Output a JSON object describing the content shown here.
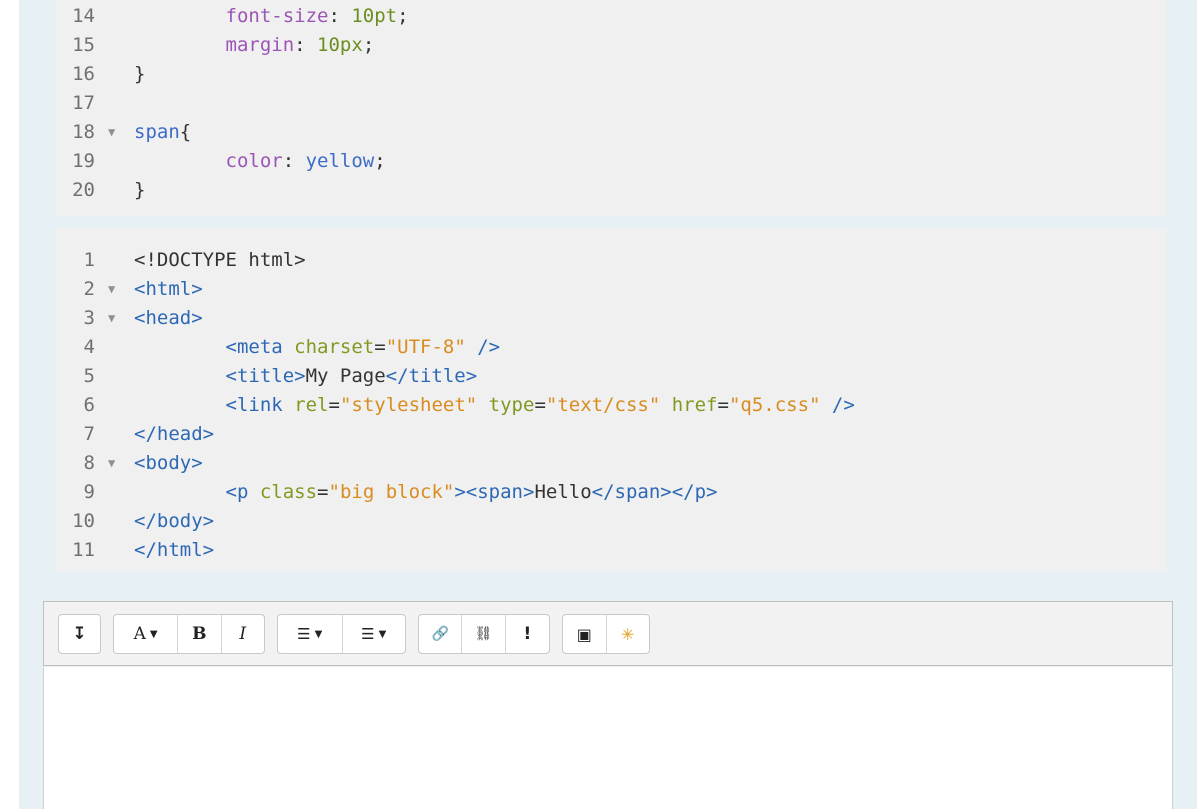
{
  "css_editor": {
    "lines": [
      {
        "num": "14",
        "fold": false,
        "segments": [
          {
            "t": "        "
          },
          {
            "t": "font-size",
            "c": "t-prop"
          },
          {
            "t": ": "
          },
          {
            "t": "10pt",
            "c": "t-num"
          },
          {
            "t": ";"
          }
        ]
      },
      {
        "num": "15",
        "fold": false,
        "segments": [
          {
            "t": "        "
          },
          {
            "t": "margin",
            "c": "t-prop"
          },
          {
            "t": ": "
          },
          {
            "t": "10px",
            "c": "t-num"
          },
          {
            "t": ";"
          }
        ]
      },
      {
        "num": "16",
        "fold": false,
        "segments": [
          {
            "t": "}"
          }
        ]
      },
      {
        "num": "17",
        "fold": false,
        "segments": []
      },
      {
        "num": "18",
        "fold": true,
        "segments": [
          {
            "t": "span",
            "c": "t-kw"
          },
          {
            "t": "{"
          }
        ]
      },
      {
        "num": "19",
        "fold": false,
        "segments": [
          {
            "t": "        "
          },
          {
            "t": "color",
            "c": "t-prop"
          },
          {
            "t": ": "
          },
          {
            "t": "yellow",
            "c": "t-kw"
          },
          {
            "t": ";"
          }
        ]
      },
      {
        "num": "20",
        "fold": false,
        "segments": [
          {
            "t": "}"
          }
        ]
      }
    ]
  },
  "html_editor": {
    "lines": [
      {
        "num": "1",
        "fold": false,
        "segments": [
          {
            "t": "<!DOCTYPE html>"
          }
        ]
      },
      {
        "num": "2",
        "fold": true,
        "segments": [
          {
            "t": "<html>",
            "c": "t-tag"
          }
        ]
      },
      {
        "num": "3",
        "fold": true,
        "segments": [
          {
            "t": "<head>",
            "c": "t-tag"
          }
        ]
      },
      {
        "num": "4",
        "fold": false,
        "segments": [
          {
            "t": "        "
          },
          {
            "t": "<meta ",
            "c": "t-tag"
          },
          {
            "t": "charset",
            "c": "t-attr"
          },
          {
            "t": "="
          },
          {
            "t": "\"UTF-8\"",
            "c": "t-str"
          },
          {
            "t": " />",
            "c": "t-tag"
          }
        ]
      },
      {
        "num": "5",
        "fold": false,
        "segments": [
          {
            "t": "        "
          },
          {
            "t": "<title>",
            "c": "t-tag"
          },
          {
            "t": "My Page"
          },
          {
            "t": "</title>",
            "c": "t-tag"
          }
        ]
      },
      {
        "num": "6",
        "fold": false,
        "segments": [
          {
            "t": "        "
          },
          {
            "t": "<link ",
            "c": "t-tag"
          },
          {
            "t": "rel",
            "c": "t-attr"
          },
          {
            "t": "="
          },
          {
            "t": "\"stylesheet\"",
            "c": "t-str"
          },
          {
            "t": " "
          },
          {
            "t": "type",
            "c": "t-attr"
          },
          {
            "t": "="
          },
          {
            "t": "\"text/css\"",
            "c": "t-str"
          },
          {
            "t": " "
          },
          {
            "t": "href",
            "c": "t-attr"
          },
          {
            "t": "="
          },
          {
            "t": "\"q5.css\"",
            "c": "t-str"
          },
          {
            "t": " />",
            "c": "t-tag"
          }
        ]
      },
      {
        "num": "7",
        "fold": false,
        "segments": [
          {
            "t": "</head>",
            "c": "t-tag"
          }
        ]
      },
      {
        "num": "8",
        "fold": true,
        "segments": [
          {
            "t": "<body>",
            "c": "t-tag"
          }
        ]
      },
      {
        "num": "9",
        "fold": false,
        "segments": [
          {
            "t": "        "
          },
          {
            "t": "<p ",
            "c": "t-tag"
          },
          {
            "t": "class",
            "c": "t-attr"
          },
          {
            "t": "="
          },
          {
            "t": "\"big block\"",
            "c": "t-str"
          },
          {
            "t": ">",
            "c": "t-tag"
          },
          {
            "t": "<span>",
            "c": "t-tag"
          },
          {
            "t": "Hello"
          },
          {
            "t": "</span>",
            "c": "t-tag"
          },
          {
            "t": "</p>",
            "c": "t-tag"
          }
        ]
      },
      {
        "num": "10",
        "fold": false,
        "segments": [
          {
            "t": "</body>",
            "c": "t-tag"
          }
        ]
      },
      {
        "num": "11",
        "fold": false,
        "segments": [
          {
            "t": "</html>",
            "c": "t-tag"
          }
        ]
      }
    ]
  },
  "toolbar": {
    "collapse_icon": "↧",
    "font_label": "A",
    "bold_label": "B",
    "italic_label": "I",
    "dropdown_caret": "▼",
    "fold_marker": "▼",
    "unordered_list_icon": "☰",
    "ordered_list_icon": "☰",
    "link_icon": "🔗",
    "unlink_icon": "⛓",
    "accessibility_icon": "!",
    "image_icon": "▣",
    "media_icon": "✳"
  }
}
